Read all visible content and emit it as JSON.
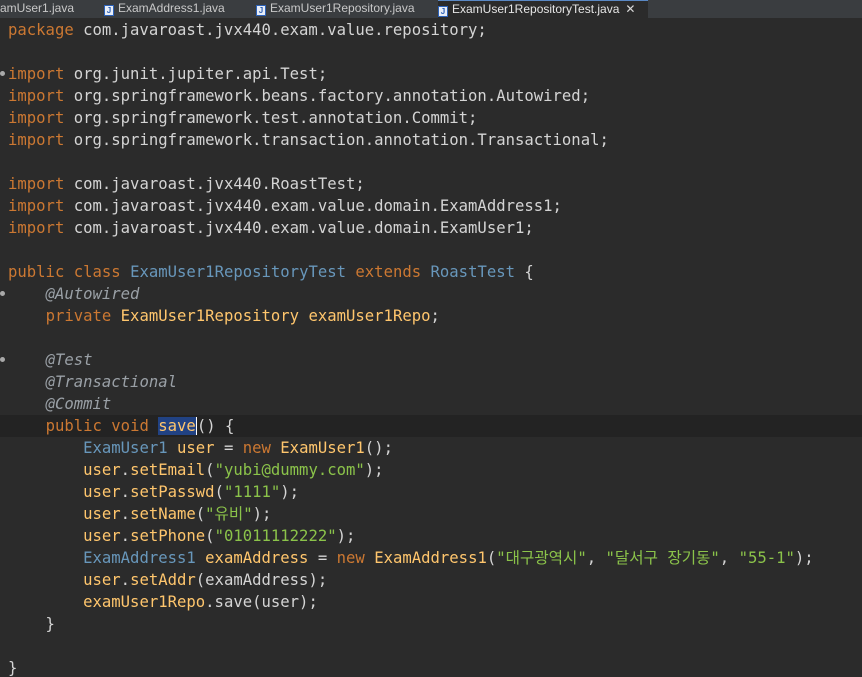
{
  "tabs": [
    {
      "label": "amUser1.java",
      "active": false
    },
    {
      "label": "ExamAddress1.java",
      "active": false
    },
    {
      "label": "ExamUser1Repository.java",
      "active": false
    },
    {
      "label": "ExamUser1RepositoryTest.java",
      "active": true
    }
  ],
  "tab_icon": "java-file-icon",
  "close_glyph": "✕",
  "code_lines": [
    {
      "fold": false,
      "tokens": [
        {
          "t": "package",
          "c": "kw"
        },
        {
          "t": " com.javaroast.jvx440.exam.value.repository;"
        }
      ]
    },
    {
      "fold": false,
      "tokens": []
    },
    {
      "fold": true,
      "tokens": [
        {
          "t": "import",
          "c": "kw"
        },
        {
          "t": " org.junit.jupiter.api.Test;"
        }
      ]
    },
    {
      "fold": false,
      "tokens": [
        {
          "t": "import",
          "c": "kw"
        },
        {
          "t": " org.springframework.beans.factory.annotation.Autowired;"
        }
      ]
    },
    {
      "fold": false,
      "tokens": [
        {
          "t": "import",
          "c": "kw"
        },
        {
          "t": " org.springframework.test.annotation.Commit;"
        }
      ]
    },
    {
      "fold": false,
      "tokens": [
        {
          "t": "import",
          "c": "kw"
        },
        {
          "t": " org.springframework.transaction.annotation.Transactional;"
        }
      ]
    },
    {
      "fold": false,
      "tokens": []
    },
    {
      "fold": false,
      "tokens": [
        {
          "t": "import",
          "c": "kw"
        },
        {
          "t": " com.javaroast.jvx440.RoastTest;"
        }
      ]
    },
    {
      "fold": false,
      "tokens": [
        {
          "t": "import",
          "c": "kw"
        },
        {
          "t": " com.javaroast.jvx440.exam.value.domain.ExamAddress1;"
        }
      ]
    },
    {
      "fold": false,
      "tokens": [
        {
          "t": "import",
          "c": "kw"
        },
        {
          "t": " com.javaroast.jvx440.exam.value.domain.ExamUser1;"
        }
      ]
    },
    {
      "fold": false,
      "tokens": []
    },
    {
      "fold": false,
      "tokens": [
        {
          "t": "public",
          "c": "kw"
        },
        {
          "t": " "
        },
        {
          "t": "class",
          "c": "kw"
        },
        {
          "t": " "
        },
        {
          "t": "ExamUser1RepositoryTest",
          "c": "ty"
        },
        {
          "t": " "
        },
        {
          "t": "extends",
          "c": "kw"
        },
        {
          "t": " "
        },
        {
          "t": "RoastTest",
          "c": "ty"
        },
        {
          "t": " {"
        }
      ]
    },
    {
      "fold": true,
      "tokens": [
        {
          "t": "    "
        },
        {
          "t": "@Autowired",
          "c": "ann"
        }
      ]
    },
    {
      "fold": false,
      "tokens": [
        {
          "t": "    "
        },
        {
          "t": "private",
          "c": "kw"
        },
        {
          "t": " "
        },
        {
          "t": "ExamUser1Repository",
          "c": "cls"
        },
        {
          "t": " "
        },
        {
          "t": "examUser1Repo",
          "c": "fld"
        },
        {
          "t": ";"
        }
      ]
    },
    {
      "fold": false,
      "tokens": []
    },
    {
      "fold": true,
      "tokens": [
        {
          "t": "    "
        },
        {
          "t": "@Test",
          "c": "ann"
        }
      ]
    },
    {
      "fold": false,
      "tokens": [
        {
          "t": "    "
        },
        {
          "t": "@Transactional",
          "c": "ann"
        }
      ]
    },
    {
      "fold": false,
      "tokens": [
        {
          "t": "    "
        },
        {
          "t": "@Commit",
          "c": "ann"
        }
      ]
    },
    {
      "fold": false,
      "current": true,
      "tokens": [
        {
          "t": "    "
        },
        {
          "t": "public",
          "c": "kw"
        },
        {
          "t": " "
        },
        {
          "t": "void",
          "c": "kw"
        },
        {
          "t": " "
        },
        {
          "t": "save",
          "c": "cls",
          "sel": true
        },
        {
          "t": "() {",
          "caret": true
        }
      ]
    },
    {
      "fold": false,
      "tokens": [
        {
          "t": "        "
        },
        {
          "t": "ExamUser1",
          "c": "ty"
        },
        {
          "t": " "
        },
        {
          "t": "user",
          "c": "fld"
        },
        {
          "t": " = "
        },
        {
          "t": "new",
          "c": "kw"
        },
        {
          "t": " "
        },
        {
          "t": "ExamUser1",
          "c": "cls"
        },
        {
          "t": "();"
        }
      ]
    },
    {
      "fold": false,
      "tokens": [
        {
          "t": "        "
        },
        {
          "t": "user",
          "c": "fld"
        },
        {
          "t": "."
        },
        {
          "t": "setEmail",
          "c": "fld"
        },
        {
          "t": "("
        },
        {
          "t": "\"yubi@dummy.com\"",
          "c": "str"
        },
        {
          "t": ");"
        }
      ]
    },
    {
      "fold": false,
      "tokens": [
        {
          "t": "        "
        },
        {
          "t": "user",
          "c": "fld"
        },
        {
          "t": "."
        },
        {
          "t": "setPasswd",
          "c": "fld"
        },
        {
          "t": "("
        },
        {
          "t": "\"1111\"",
          "c": "str"
        },
        {
          "t": ");"
        }
      ]
    },
    {
      "fold": false,
      "tokens": [
        {
          "t": "        "
        },
        {
          "t": "user",
          "c": "fld"
        },
        {
          "t": "."
        },
        {
          "t": "setName",
          "c": "fld"
        },
        {
          "t": "("
        },
        {
          "t": "\"유비\"",
          "c": "str"
        },
        {
          "t": ");"
        }
      ]
    },
    {
      "fold": false,
      "tokens": [
        {
          "t": "        "
        },
        {
          "t": "user",
          "c": "fld"
        },
        {
          "t": "."
        },
        {
          "t": "setPhone",
          "c": "fld"
        },
        {
          "t": "("
        },
        {
          "t": "\"01011112222\"",
          "c": "str"
        },
        {
          "t": ");"
        }
      ]
    },
    {
      "fold": false,
      "tokens": [
        {
          "t": "        "
        },
        {
          "t": "ExamAddress1",
          "c": "ty"
        },
        {
          "t": " "
        },
        {
          "t": "examAddress",
          "c": "fld"
        },
        {
          "t": " = "
        },
        {
          "t": "new",
          "c": "kw"
        },
        {
          "t": " "
        },
        {
          "t": "ExamAddress1",
          "c": "cls"
        },
        {
          "t": "("
        },
        {
          "t": "\"대구광역시\"",
          "c": "str"
        },
        {
          "t": ", "
        },
        {
          "t": "\"달서구 장기동\"",
          "c": "str"
        },
        {
          "t": ", "
        },
        {
          "t": "\"55-1\"",
          "c": "str"
        },
        {
          "t": ");"
        }
      ]
    },
    {
      "fold": false,
      "tokens": [
        {
          "t": "        "
        },
        {
          "t": "user",
          "c": "fld"
        },
        {
          "t": "."
        },
        {
          "t": "setAddr",
          "c": "fld"
        },
        {
          "t": "(examAddress);"
        }
      ]
    },
    {
      "fold": false,
      "tokens": [
        {
          "t": "        "
        },
        {
          "t": "examUser1Repo",
          "c": "fld"
        },
        {
          "t": ".save(user);"
        }
      ]
    },
    {
      "fold": false,
      "tokens": [
        {
          "t": "    }"
        }
      ]
    },
    {
      "fold": false,
      "tokens": []
    },
    {
      "fold": false,
      "tokens": [
        {
          "t": "}"
        }
      ]
    }
  ]
}
